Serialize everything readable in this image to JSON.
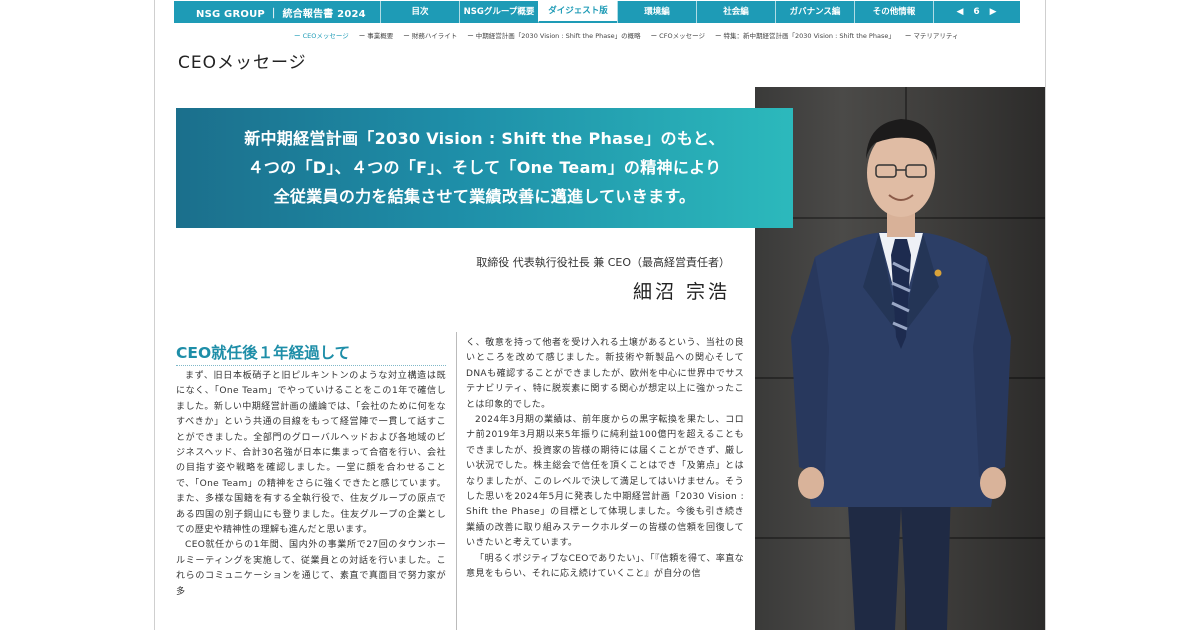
{
  "header": {
    "brand": "NSG GROUP ｜ 統合報告書 2024",
    "tabs": [
      {
        "label": "目次"
      },
      {
        "label": "NSGグループ概要"
      },
      {
        "label": "ダイジェスト版"
      },
      {
        "label": "環境編"
      },
      {
        "label": "社会編"
      },
      {
        "label": "ガバナンス編"
      },
      {
        "label": "その他情報"
      }
    ],
    "page_number": "6"
  },
  "subnav": [
    "ー CEOメッセージ",
    "ー 事業概要",
    "ー 財務ハイライト",
    "ー 中期経営計画「2030 Vision : Shift the Phase」の概略",
    "ー CFOメッセージ",
    "ー 特集：新中期経営計画「2030 Vision : Shift the Phase」",
    "ー マテリアリティ"
  ],
  "page_title": "CEOメッセージ",
  "banner": {
    "line1": "新中期経営計画「2030 Vision : Shift the Phase」のもと、",
    "line2": "４つの「D」、４つの「F」、そして「One Team」の精神により",
    "line3": "全従業員の力を結集させて業績改善に邁進していきます。"
  },
  "ceo": {
    "role": "取締役 代表執行役社長 兼 CEO（最高経営責任者）",
    "name": "細沼 宗浩"
  },
  "section": {
    "heading": "CEO就任後１年経過して"
  },
  "body": {
    "col1_p1": "まず、旧日本板硝子と旧ピルキントンのような対立構造は既になく、「One Team」でやっていけることをこの1年で確信しました。新しい中期経営計画の議論では、「会社のために何をなすべきか」という共通の目線をもって経営陣で一貫して話すことができました。全部門のグローバルヘッドおよび各地域のビジネスヘッド、合計30名強が日本に集まって合宿を行い、会社の目指す姿や戦略を確認しました。一堂に顔を合わせることで、「One Team」の精神をさらに強くできたと感じています。また、多様な国籍を有する全執行役で、住友グループの原点である四国の別子銅山にも登りました。住友グループの企業としての歴史や精神性の理解も進んだと思います。",
    "col1_p2": "CEO就任からの1年間、国内外の事業所で27回のタウンホールミーティングを実施して、従業員との対話を行いました。これらのコミュニケーションを通じて、素直で真面目で努力家が多",
    "col2_p1": "く、敬意を持って他者を受け入れる土壌があるという、当社の良いところを改めて感じました。新技術や新製品への関心そしてDNAも確認することができましたが、欧州を中心に世界中でサステナビリティ、特に脱炭素に関する関心が想定以上に強かったことは印象的でした。",
    "col2_p2": "2024年3月期の業績は、前年度からの黒字転換を果たし、コロナ前2019年3月期以来5年振りに純利益100億円を超えることもできましたが、投資家の皆様の期待には届くことができず、厳しい状況でした。株主総会で信任を頂くことはでき「及第点」とはなりましたが、このレベルで決して満足してはいけません。そうした思いを2024年5月に発表した中期経営計画「2030 Vision : Shift the Phase」の目標として体現しました。今後も引き続き業績の改善に取り組みステークホルダーの皆様の信頼を回復していきたいと考えています。",
    "col2_p3": "「明るくポジティブなCEOでありたい」、「『信頼を得て、率直な意見をもらい、それに応え続けていくこと』が自分の信"
  }
}
